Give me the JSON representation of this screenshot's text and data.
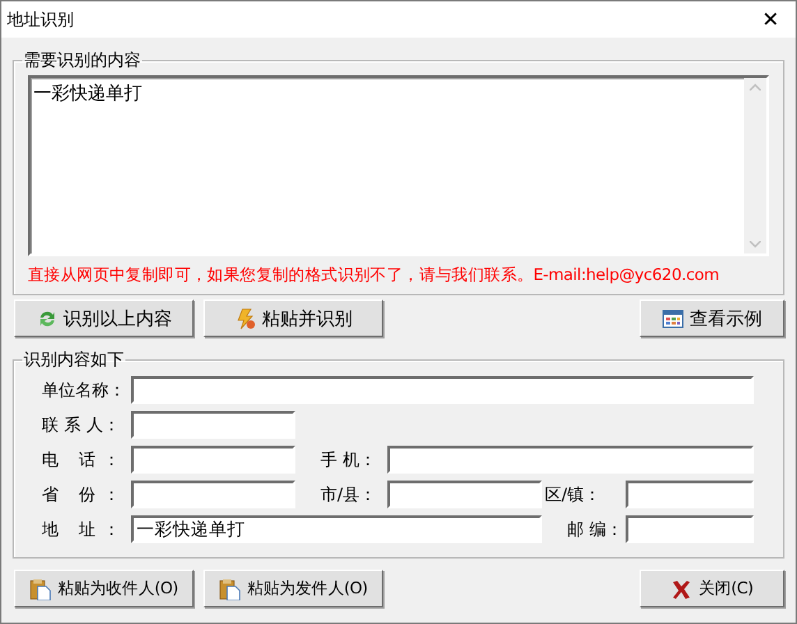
{
  "window": {
    "title": "地址识别",
    "close": "✕"
  },
  "source": {
    "legend": "需要识别的内容",
    "value": "一彩快递单打",
    "hint": "直接从网页中复制即可，如果您复制的格式识别不了，请与我们联系。E-mail:help@yc620.com"
  },
  "actions": [
    {
      "label": "识别以上内容",
      "kind": "recognize"
    },
    {
      "label": "粘贴并识别",
      "kind": "paste-recognize"
    },
    {
      "label": "查看示例",
      "kind": "example"
    }
  ],
  "result": {
    "legend": "识别内容如下",
    "rows": [
      [
        {
          "label": "单位名称："
        }
      ],
      [
        {
          "label": "联 系 人："
        }
      ],
      [
        {
          "label": "电 话："
        },
        {
          "label": "手 机："
        }
      ],
      [
        {
          "label": "省 份："
        },
        {
          "label": "市/县："
        },
        {
          "label": "区/镇："
        }
      ],
      [
        {
          "label": "地 址：",
          "value": "一彩快递单打"
        },
        {
          "label": "邮 编："
        }
      ]
    ]
  },
  "footer": [
    {
      "label": "粘贴为收件人(O)",
      "kind": "paste"
    },
    {
      "label": "粘贴为发件人(O)",
      "kind": "paste"
    },
    {
      "label": "关闭(C)",
      "kind": "close"
    }
  ]
}
